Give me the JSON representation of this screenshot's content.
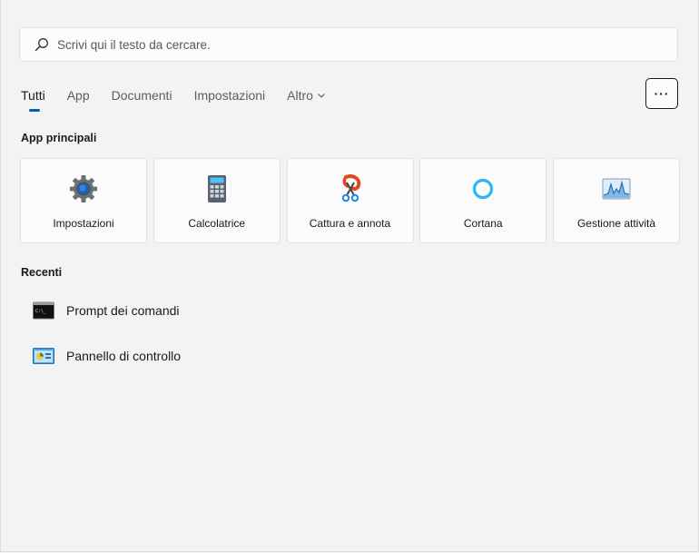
{
  "search": {
    "placeholder": "Scrivi qui il testo da cercare."
  },
  "tabs": [
    {
      "label": "Tutti"
    },
    {
      "label": "App"
    },
    {
      "label": "Documenti"
    },
    {
      "label": "Impostazioni"
    },
    {
      "label": "Altro"
    }
  ],
  "more_button": {
    "label": "···"
  },
  "top_apps": {
    "title": "App principali",
    "items": [
      {
        "label": "Impostazioni",
        "icon": "settings-gear-icon"
      },
      {
        "label": "Calcolatrice",
        "icon": "calculator-icon"
      },
      {
        "label": "Cattura e annota",
        "icon": "snip-sketch-icon"
      },
      {
        "label": "Cortana",
        "icon": "cortana-ring-icon"
      },
      {
        "label": "Gestione attività",
        "icon": "task-manager-icon"
      }
    ]
  },
  "recent": {
    "title": "Recenti",
    "items": [
      {
        "label": "Prompt dei comandi",
        "icon": "command-prompt-icon"
      },
      {
        "label": "Pannello di controllo",
        "icon": "control-panel-icon"
      }
    ]
  },
  "colors": {
    "background": "#f3f3f3",
    "accent": "#005fb8",
    "tile": "#fbfbfb"
  }
}
